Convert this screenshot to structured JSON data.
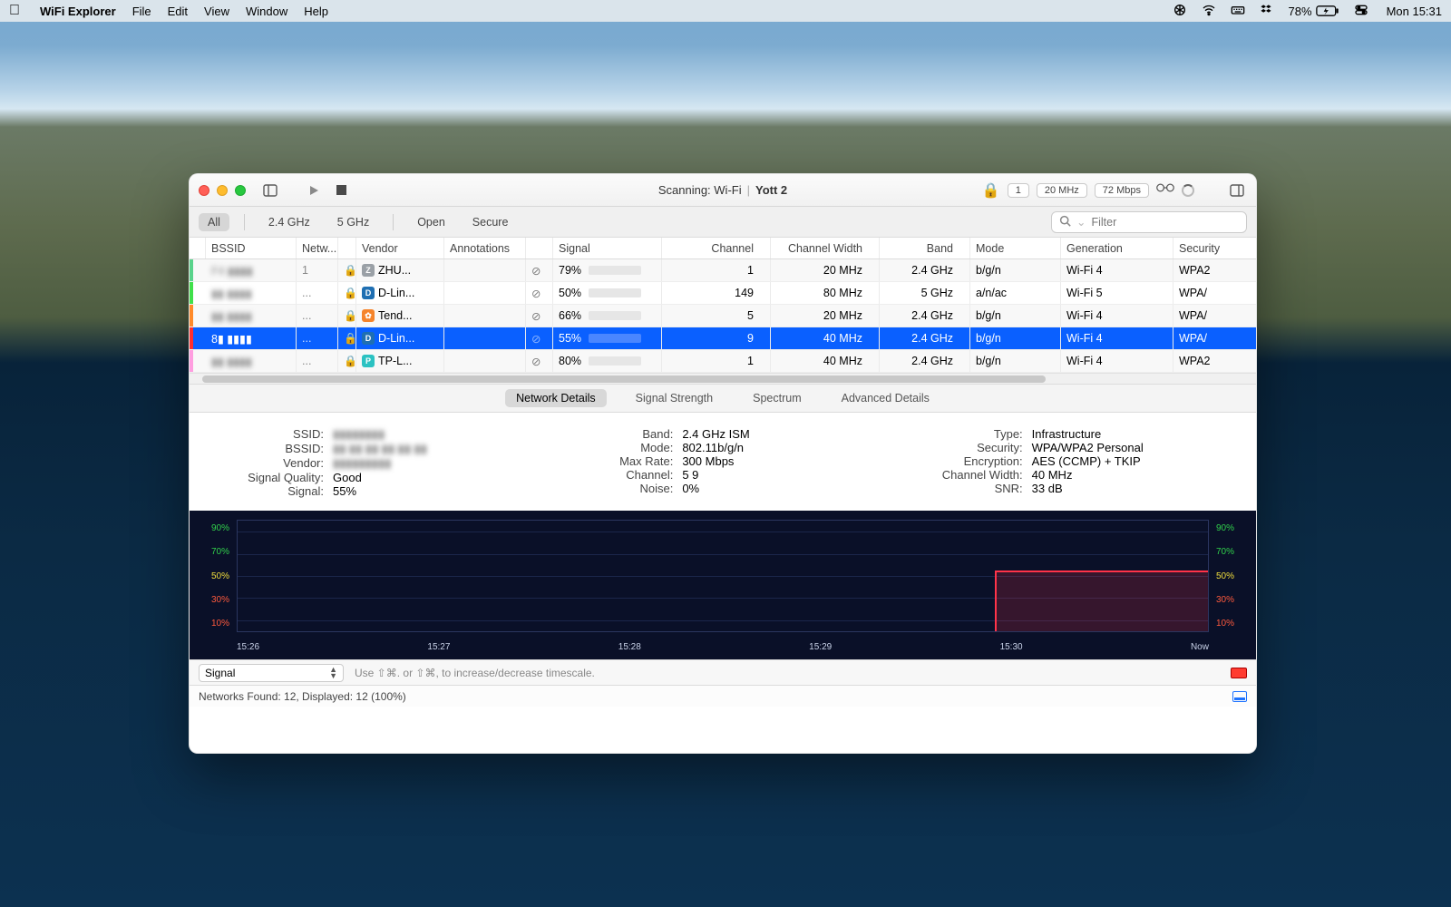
{
  "menubar": {
    "app": "WiFi Explorer",
    "items": [
      "File",
      "Edit",
      "View",
      "Window",
      "Help"
    ],
    "battery_text": "78%",
    "clock": "Mon 15:31"
  },
  "titlebar": {
    "status": "Scanning: Wi-Fi",
    "network_name": "Yott 2",
    "pill_count": "1",
    "pill_width": "20 MHz",
    "pill_rate": "72 Mbps"
  },
  "filters": {
    "all": "All",
    "g24": "2.4 GHz",
    "g5": "5 GHz",
    "open": "Open",
    "secure": "Secure",
    "search_placeholder": "Filter"
  },
  "columns": [
    "",
    "BSSID",
    "Netw...",
    "",
    "Vendor",
    "Annotations",
    "",
    "Signal",
    "Channel",
    "Channel Width",
    "Band",
    "Mode",
    "Generation",
    "Security"
  ],
  "rows": [
    {
      "color": "#59d38b",
      "bssid": "F4 ▮▮▮▮",
      "net": "1",
      "vendor": "ZHU...",
      "vicon": "#9aa0a6",
      "vchar": "Z",
      "sig": "79%",
      "sigv": 79,
      "ch": "1",
      "cw": "20 MHz",
      "band": "2.4 GHz",
      "mode": "b/g/n",
      "gen": "Wi-Fi 4",
      "sec": "WPA2"
    },
    {
      "color": "#3fe04a",
      "bssid": "▮▮ ▮▮▮▮",
      "net": "...",
      "vendor": "D-Lin...",
      "vicon": "#1f6fb2",
      "vchar": "D",
      "sig": "50%",
      "sigv": 50,
      "ch": "149",
      "cw": "80 MHz",
      "band": "5 GHz",
      "mode": "a/n/ac",
      "gen": "Wi-Fi 5",
      "sec": "WPA/"
    },
    {
      "color": "#ff8a2a",
      "bssid": "▮▮ ▮▮▮▮",
      "net": "...",
      "vendor": "Tend...",
      "vicon": "#f5842b",
      "vchar": "✿",
      "sig": "66%",
      "sigv": 66,
      "ch": "5",
      "cw": "20 MHz",
      "band": "2.4 GHz",
      "mode": "b/g/n",
      "gen": "Wi-Fi 4",
      "sec": "WPA/"
    },
    {
      "color": "#ff2d2d",
      "bssid": "8▮ ▮▮▮▮",
      "net": "...",
      "vendor": "D-Lin...",
      "vicon": "#1f6fb2",
      "vchar": "D",
      "sig": "55%",
      "sigv": 55,
      "ch": "9",
      "cw": "40 MHz",
      "band": "2.4 GHz",
      "mode": "b/g/n",
      "gen": "Wi-Fi 4",
      "sec": "WPA/",
      "selected": true
    },
    {
      "color": "#ff9ee0",
      "bssid": "▮▮ ▮▮▮▮",
      "net": "...",
      "vendor": "TP-L...",
      "vicon": "#2cc2c2",
      "vchar": "P",
      "sig": "80%",
      "sigv": 80,
      "ch": "1",
      "cw": "40 MHz",
      "band": "2.4 GHz",
      "mode": "b/g/n",
      "gen": "Wi-Fi 4",
      "sec": "WPA2"
    }
  ],
  "tabs": {
    "details": "Network Details",
    "strength": "Signal Strength",
    "spectrum": "Spectrum",
    "adv": "Advanced Details"
  },
  "details": {
    "col1": [
      {
        "lab": "SSID:",
        "val": "▮▮▮▮▮▮▮▮",
        "blur": true
      },
      {
        "lab": "BSSID:",
        "val": "▮▮:▮▮:▮▮:▮▮:▮▮:▮▮",
        "blur": true
      },
      {
        "lab": "Vendor:",
        "val": "▮▮▮▮▮▮▮▮▮",
        "blur": true
      },
      {
        "lab": "Signal Quality:",
        "val": "Good"
      },
      {
        "lab": "Signal:",
        "val": "55%"
      }
    ],
    "col2": [
      {
        "lab": "Band:",
        "val": "2.4 GHz ISM"
      },
      {
        "lab": "Mode:",
        "val": "802.11b/g/n"
      },
      {
        "lab": "Max Rate:",
        "val": "300 Mbps"
      },
      {
        "lab": "Channel:",
        "val": "5 9"
      },
      {
        "lab": "Noise:",
        "val": "0%"
      }
    ],
    "col3": [
      {
        "lab": "Type:",
        "val": "Infrastructure"
      },
      {
        "lab": "Security:",
        "val": "WPA/WPA2 Personal"
      },
      {
        "lab": "Encryption:",
        "val": "AES (CCMP) + TKIP"
      },
      {
        "lab": "Channel Width:",
        "val": "40 MHz"
      },
      {
        "lab": "SNR:",
        "val": "33 dB"
      }
    ]
  },
  "chart_data": {
    "type": "line",
    "title": "",
    "xlabel": "",
    "ylabel": "",
    "ylim": [
      0,
      100
    ],
    "y_ticks": [
      "90%",
      "70%",
      "50%",
      "30%",
      "10%"
    ],
    "categories": [
      "15:26",
      "15:27",
      "15:28",
      "15:29",
      "15:30",
      "Now"
    ],
    "series": [
      {
        "name": "Selected network signal",
        "values": [
          null,
          null,
          null,
          null,
          55,
          55
        ],
        "start_fraction": 0.78
      }
    ]
  },
  "bottombar": {
    "select": "Signal",
    "hint": "Use ⇧⌘. or ⇧⌘, to increase/decrease timescale."
  },
  "statusbar": {
    "text": "Networks Found: 12, Displayed: 12 (100%)"
  }
}
